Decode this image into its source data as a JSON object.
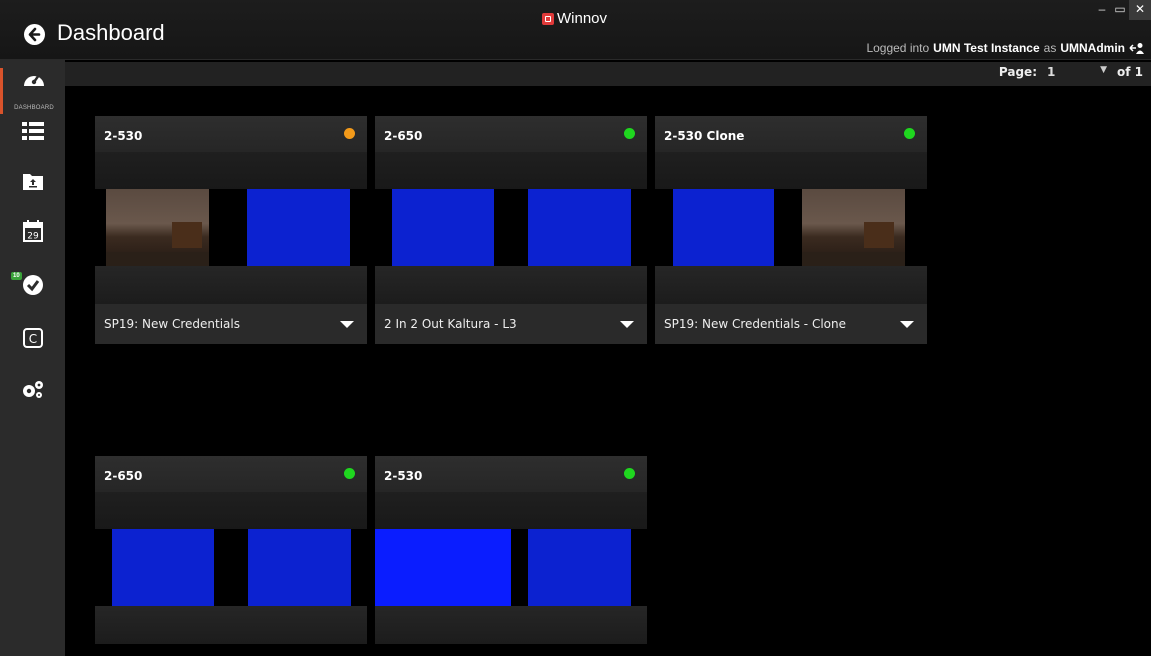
{
  "header": {
    "title": "Dashboard",
    "brand": "Winnov",
    "login_prefix": "Logged into",
    "instance": "UMN Test Instance",
    "login_mid": "as",
    "user": "UMNAdmin"
  },
  "window_controls": {
    "minimize": "–",
    "restore": "▭",
    "close": "✕"
  },
  "sidebar": {
    "items": [
      {
        "label": "DASHBOARD",
        "icon": "dashboard-gauge-icon"
      },
      {
        "label": "",
        "icon": "list-icon"
      },
      {
        "label": "",
        "icon": "folder-upload-icon"
      },
      {
        "label": "29",
        "icon": "calendar-icon"
      },
      {
        "label": "10",
        "icon": "checkmark-circle-icon"
      },
      {
        "label": "C",
        "icon": "c-box-icon"
      },
      {
        "label": "",
        "icon": "gears-icon"
      }
    ]
  },
  "pager": {
    "label": "Page:",
    "current": "1",
    "of_label": "of 1"
  },
  "colors": {
    "status_orange": "#f39a1a",
    "status_green": "#1fd61f",
    "accent": "#d9532b"
  },
  "tiles": [
    {
      "name": "2-530",
      "status": "orange",
      "description": "SP19: New Credentials",
      "panes": [
        "room",
        "blue"
      ]
    },
    {
      "name": "2-650",
      "status": "green",
      "description": "2 In 2 Out Kaltura - L3",
      "panes": [
        "blue",
        "blue"
      ]
    },
    {
      "name": "2-530 Clone",
      "status": "green",
      "description": "SP19: New Credentials - Clone",
      "panes": [
        "blue",
        "room"
      ]
    },
    {
      "name": "2-650",
      "status": "green",
      "description": "",
      "panes": [
        "blue",
        "blue"
      ]
    },
    {
      "name": "2-530",
      "status": "green",
      "description": "",
      "panes": [
        "bright",
        "blue"
      ]
    }
  ]
}
